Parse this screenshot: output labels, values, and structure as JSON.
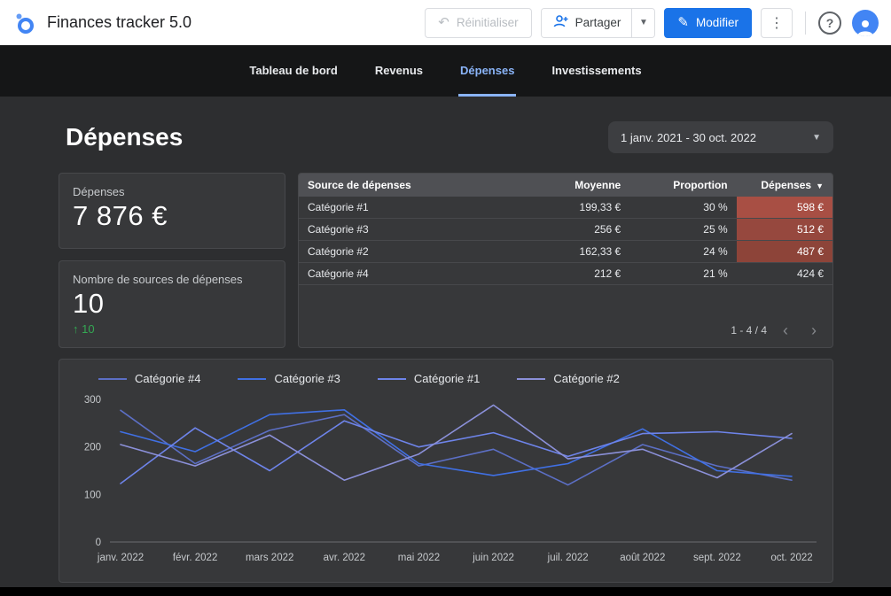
{
  "topbar": {
    "title": "Finances tracker 5.0",
    "reset_label": "Réinitialiser",
    "share_label": "Partager",
    "edit_label": "Modifier"
  },
  "tabs": [
    {
      "label": "Tableau de bord",
      "active": false
    },
    {
      "label": "Revenus",
      "active": false
    },
    {
      "label": "Dépenses",
      "active": true
    },
    {
      "label": "Investissements",
      "active": false
    }
  ],
  "page": {
    "title": "Dépenses",
    "date_range": "1 janv. 2021 - 30 oct. 2022"
  },
  "scorecards": [
    {
      "label": "Dépenses",
      "value": "7 876 €"
    },
    {
      "label": "Nombre de sources de dépenses",
      "value": "10",
      "delta_arrow": "↑",
      "delta": "10"
    }
  ],
  "table": {
    "columns": [
      "Source de dépenses",
      "Moyenne",
      "Proportion",
      "Dépenses"
    ],
    "sorted_desc_by": "Dépenses",
    "rows": [
      {
        "source": "Catégorie #1",
        "moyenne": "199,33 €",
        "proportion": "30 %",
        "depenses": "598 €",
        "heat": "#a84f44"
      },
      {
        "source": "Catégorie #3",
        "moyenne": "256 €",
        "proportion": "25 %",
        "depenses": "512 €",
        "heat": "#96483e"
      },
      {
        "source": "Catégorie #2",
        "moyenne": "162,33 €",
        "proportion": "24 %",
        "depenses": "487 €",
        "heat": "#8d4439"
      },
      {
        "source": "Catégorie #4",
        "moyenne": "212 €",
        "proportion": "21 %",
        "depenses": "424 €",
        "heat": ""
      }
    ],
    "pagination": "1 - 4 / 4"
  },
  "chart_data": {
    "type": "line",
    "title": "",
    "xlabel": "",
    "ylabel": "",
    "categories": [
      "janv. 2022",
      "févr. 2022",
      "mars 2022",
      "avr. 2022",
      "mai 2022",
      "juin 2022",
      "juil. 2022",
      "août 2022",
      "sept. 2022",
      "oct. 2022"
    ],
    "series": [
      {
        "name": "Catégorie #4",
        "color": "#5c6fc5",
        "values": [
          277,
          165,
          235,
          268,
          160,
          195,
          120,
          205,
          160,
          130
        ]
      },
      {
        "name": "Catégorie #3",
        "color": "#4070e4",
        "values": [
          232,
          190,
          268,
          278,
          165,
          140,
          165,
          238,
          150,
          138
        ]
      },
      {
        "name": "Catégorie #1",
        "color": "#6e84ea",
        "values": [
          123,
          240,
          150,
          255,
          200,
          230,
          180,
          228,
          232,
          218
        ]
      },
      {
        "name": "Catégorie #2",
        "color": "#8b90d9",
        "values": [
          205,
          160,
          225,
          130,
          185,
          288,
          175,
          195,
          135,
          228
        ]
      }
    ],
    "ylim": [
      0,
      300
    ],
    "yticks": [
      0,
      100,
      200,
      300
    ],
    "legend_position": "top",
    "grid": false
  }
}
